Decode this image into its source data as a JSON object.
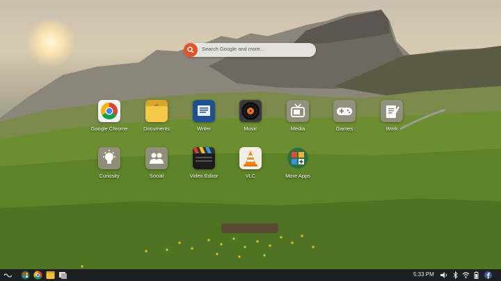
{
  "search": {
    "placeholder": "Search Google and more..."
  },
  "apps": [
    {
      "label": "Google Chrome",
      "icon": "chrome-icon"
    },
    {
      "label": "Documents",
      "icon": "folder-icon"
    },
    {
      "label": "Writer",
      "icon": "writer-icon"
    },
    {
      "label": "Music",
      "icon": "vinyl-record-icon"
    },
    {
      "label": "Media",
      "icon": "tv-icon"
    },
    {
      "label": "Games",
      "icon": "gamepad-icon"
    },
    {
      "label": "Work",
      "icon": "clipboard-pencil-icon"
    },
    {
      "label": "Curiosity",
      "icon": "lightbulb-icon"
    },
    {
      "label": "Social",
      "icon": "people-icon"
    },
    {
      "label": "Video Editor",
      "icon": "clapperboard-icon"
    },
    {
      "label": "VLC",
      "icon": "vlc-cone-icon"
    },
    {
      "label": "More Apps",
      "icon": "app-store-icon"
    }
  ],
  "taskbar": {
    "clock": "5:33 PM",
    "pinned": [
      "endless-logo-icon",
      "app-center-icon",
      "chrome-icon",
      "folder-icon",
      "workspace-icon"
    ],
    "tray": [
      "volume-icon",
      "bluetooth-icon",
      "wifi-icon",
      "battery-icon",
      "facebook-icon"
    ]
  },
  "colors": {
    "search_button": "#e2522c",
    "taskbar": "#1d1f22"
  }
}
